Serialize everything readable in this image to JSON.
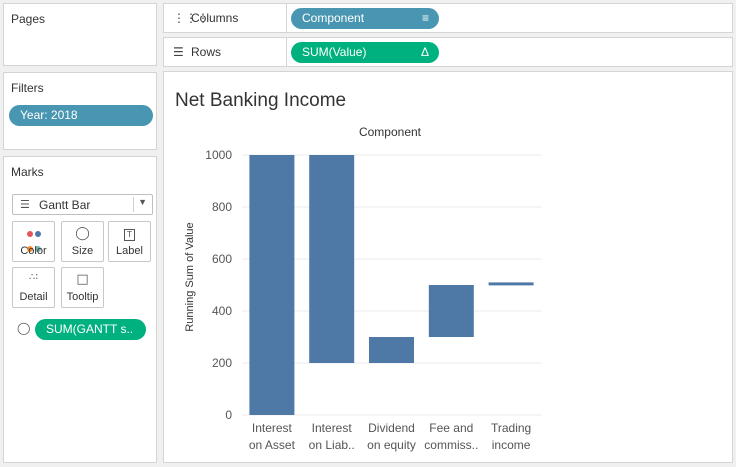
{
  "left_panel": {
    "pages": {
      "title": "Pages"
    },
    "filters": {
      "title": "Filters",
      "pills": [
        {
          "label": "Year: 2018"
        }
      ]
    },
    "marks": {
      "title": "Marks",
      "mark_type": "Gantt Bar",
      "buttons": [
        {
          "label": "Color",
          "icon": "color-icon"
        },
        {
          "label": "Size",
          "icon": "size-icon"
        },
        {
          "label": "Label",
          "icon": "label-icon",
          "glyph": "T"
        },
        {
          "label": "Detail",
          "icon": "detail-icon"
        },
        {
          "label": "Tooltip",
          "icon": "tooltip-icon"
        }
      ],
      "size_pill": {
        "label": "SUM(GANTT s..",
        "icon": "size-icon"
      }
    }
  },
  "shelves": {
    "columns": {
      "label": "Columns",
      "icon": "columns-icon",
      "pill": "Component",
      "pill_icon": "sort-icon"
    },
    "rows": {
      "label": "Rows",
      "icon": "rows-icon",
      "pill": "SUM(Value)",
      "pill_icon": "delta-icon",
      "pill_glyph": "Δ"
    }
  },
  "colors": {
    "dimension_pill": "#4996b2",
    "measure_pill": "#00b180",
    "bar": "#4e79a7"
  },
  "chart_data": {
    "type": "bar",
    "subtype": "waterfall-gantt",
    "title": "Net Banking Income",
    "header": "Component",
    "ylabel": "Running Sum of Value",
    "ylim": [
      0,
      1000
    ],
    "yticks": [
      0,
      200,
      400,
      600,
      800,
      1000
    ],
    "categories": [
      [
        "Interest",
        "on Asset"
      ],
      [
        "Interest",
        "on Liab.."
      ],
      [
        "Dividend",
        "on equity"
      ],
      [
        "Fee and",
        "commiss.."
      ],
      [
        "Trading",
        "income"
      ]
    ],
    "bars": [
      {
        "start": 0,
        "end": 1000
      },
      {
        "start": 200,
        "end": 1000
      },
      {
        "start": 200,
        "end": 300
      },
      {
        "start": 300,
        "end": 500
      },
      {
        "start": 500,
        "end": 510
      }
    ],
    "grid": true
  }
}
